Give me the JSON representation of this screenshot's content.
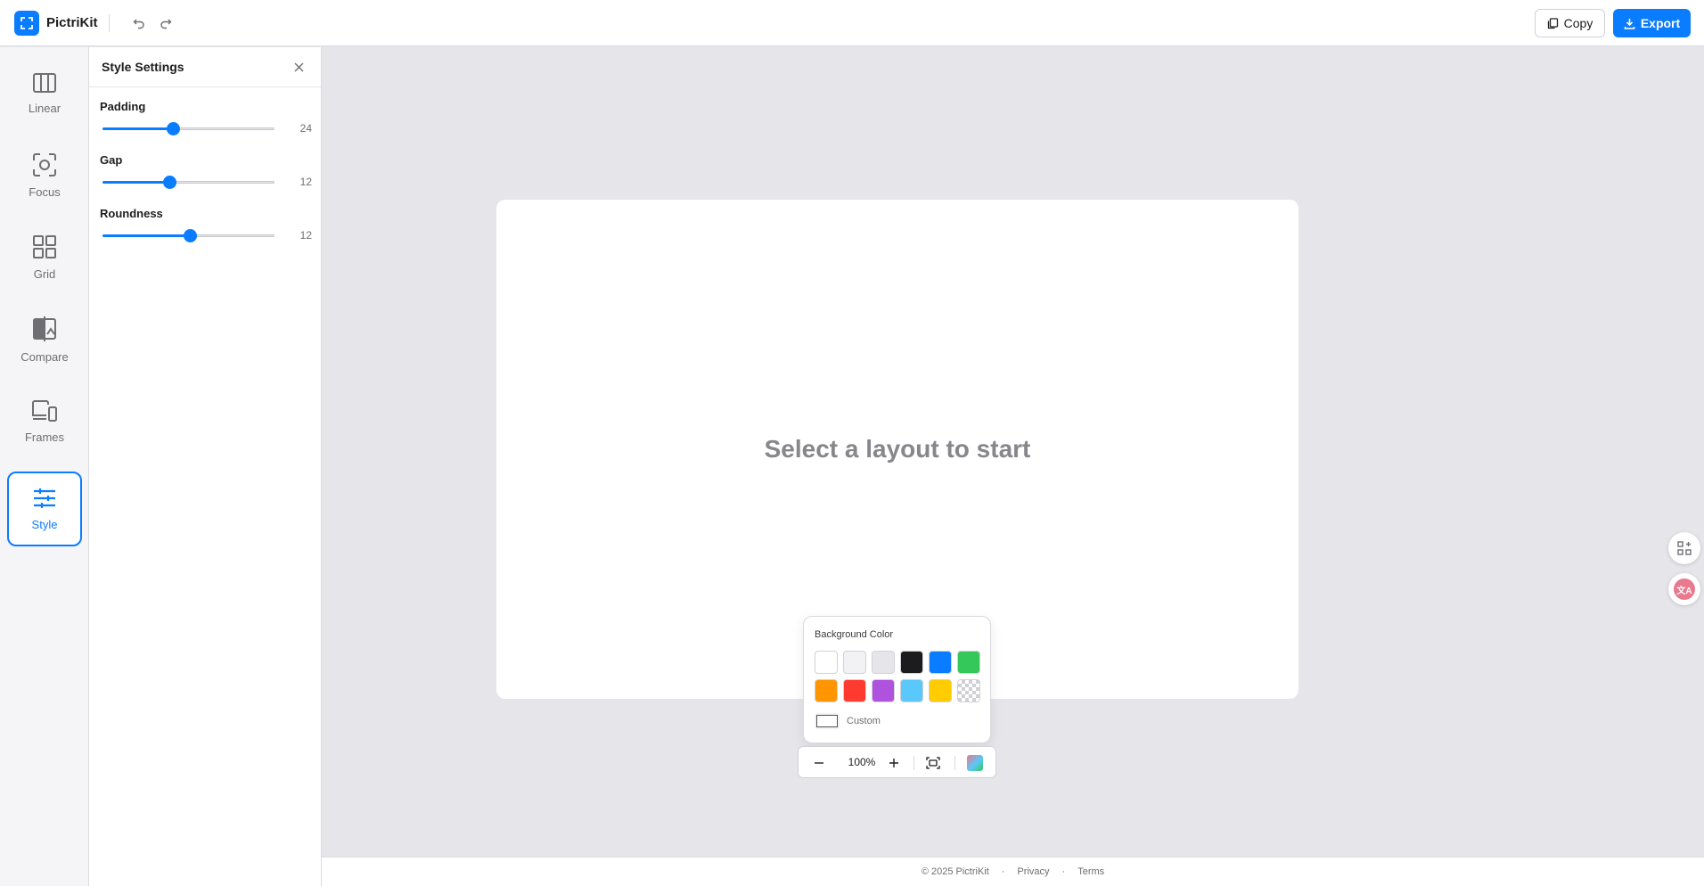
{
  "app": {
    "name": "PictriKit"
  },
  "toolbar": {
    "copy_label": "Copy",
    "export_label": "Export"
  },
  "rail": {
    "items": [
      {
        "label": "Linear",
        "icon": "columns-icon"
      },
      {
        "label": "Focus",
        "icon": "focus-icon"
      },
      {
        "label": "Grid",
        "icon": "grid-icon"
      },
      {
        "label": "Compare",
        "icon": "compare-icon"
      },
      {
        "label": "Frames",
        "icon": "devices-icon"
      },
      {
        "label": "Style",
        "icon": "sliders-icon",
        "active": true
      }
    ]
  },
  "panel": {
    "title": "Style Settings",
    "settings": [
      {
        "label": "Padding",
        "value": "24",
        "fraction": 0.41
      },
      {
        "label": "Gap",
        "value": "12",
        "fraction": 0.39
      },
      {
        "label": "Roundness",
        "value": "12",
        "fraction": 0.51
      }
    ]
  },
  "canvas": {
    "placeholder": "Select a layout to start"
  },
  "background_popover": {
    "title": "Background Color",
    "swatches": [
      "#ffffff",
      "#f2f2f4",
      "#e5e5ea",
      "#1c1c1e",
      "#0a7cff",
      "#34c759",
      "#ff9500",
      "#ff3b30",
      "#af52de",
      "#5ac8fa",
      "#ffcc00",
      "transparent"
    ],
    "custom_label": "Custom"
  },
  "zoom": {
    "value": "100%"
  },
  "footer": {
    "copyright": "© 2025 PictriKit",
    "sep": "·",
    "privacy": "Privacy",
    "terms": "Terms"
  },
  "colors": {
    "accent": "#0a7cff",
    "canvas_bg": "#e5e5ea"
  }
}
